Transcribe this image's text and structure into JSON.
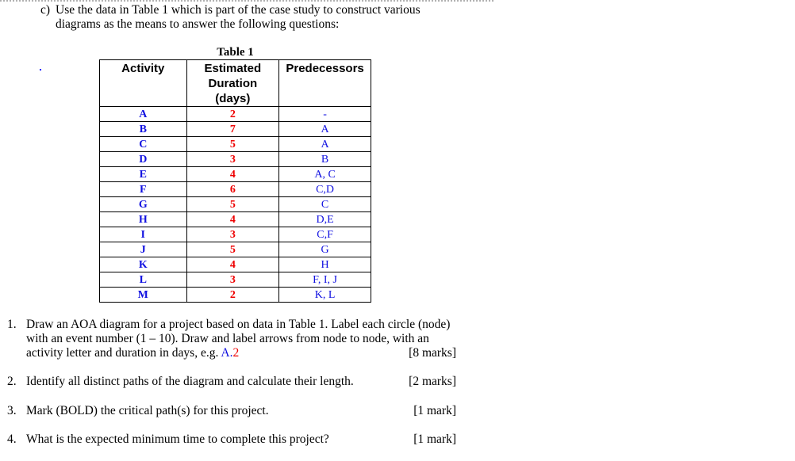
{
  "intro": {
    "label": "c)",
    "line1": "Use the data in Table 1 which is part of the case study to construct various",
    "line2": "diagrams as the means to answer the following questions:"
  },
  "table": {
    "caption": "Table 1",
    "headers": [
      "Activity",
      "Estimated Duration (days)",
      "Predecessors"
    ],
    "header_lines": {
      "activity": "Activity",
      "duration_1": "Estimated",
      "duration_2": "Duration",
      "duration_3": "(days)",
      "predecessors": "Predecessors"
    },
    "rows": [
      {
        "activity": "A",
        "duration": "2",
        "predecessors": "-"
      },
      {
        "activity": "B",
        "duration": "7",
        "predecessors": "A"
      },
      {
        "activity": "C",
        "duration": "5",
        "predecessors": "A"
      },
      {
        "activity": "D",
        "duration": "3",
        "predecessors": "B"
      },
      {
        "activity": "E",
        "duration": "4",
        "predecessors": "A, C"
      },
      {
        "activity": "F",
        "duration": "6",
        "predecessors": "C,D"
      },
      {
        "activity": "G",
        "duration": "5",
        "predecessors": "C"
      },
      {
        "activity": "H",
        "duration": "4",
        "predecessors": "D,E"
      },
      {
        "activity": "I",
        "duration": "3",
        "predecessors": "C,F"
      },
      {
        "activity": "J",
        "duration": "5",
        "predecessors": "G"
      },
      {
        "activity": "K",
        "duration": "4",
        "predecessors": "H"
      },
      {
        "activity": "L",
        "duration": "3",
        "predecessors": "F, I, J"
      },
      {
        "activity": "M",
        "duration": "2",
        "predecessors": "K, L"
      }
    ]
  },
  "colors": {
    "activity": "#1010e0",
    "duration": "#ee0000"
  },
  "questions": [
    {
      "number": "1.",
      "line1": "Draw an AOA diagram for a project based on data in Table 1. Label each circle (node)",
      "line2": "with an event number (1 – 10). Draw and label arrows from node to node, with an",
      "line3": "activity letter and duration in days, e.g.",
      "example_letter": "A.",
      "example_duration": "2",
      "marks": "[8 marks]"
    },
    {
      "number": "2.",
      "text": "Identify all distinct paths of the diagram and calculate their length.",
      "marks": "[2 marks]"
    },
    {
      "number": "3.",
      "text": "Mark (BOLD) the critical path(s) for this project.",
      "marks": "[1 mark]"
    },
    {
      "number": "4.",
      "text": "What is the expected minimum time to complete this project?",
      "marks": "[1 mark]"
    }
  ]
}
